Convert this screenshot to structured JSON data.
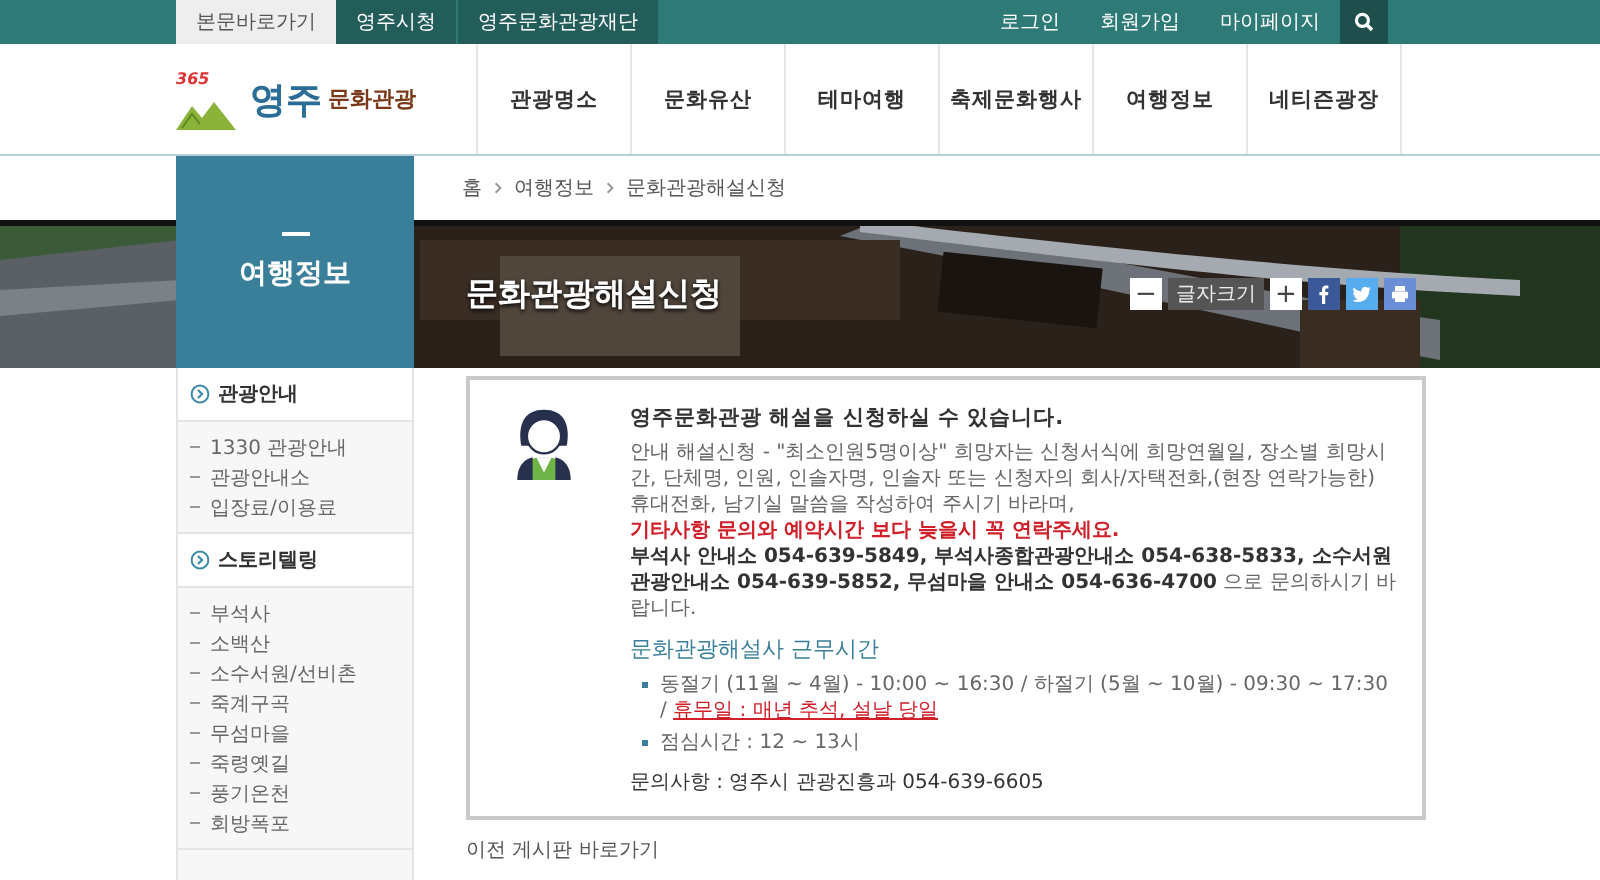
{
  "top_bar": {
    "left_links": [
      {
        "label": "본문바로가기",
        "kind": "skip"
      },
      {
        "label": "영주시청",
        "kind": "site"
      },
      {
        "label": "영주문화관광재단",
        "kind": "site"
      }
    ],
    "right_links": [
      "로그인",
      "회원가입",
      "마이페이지"
    ]
  },
  "logo": {
    "badge": "365",
    "city": "영주",
    "subtitle": "문화관광"
  },
  "nav": [
    "관광명소",
    "문화유산",
    "테마여행",
    "축제문화행사",
    "여행정보",
    "네티즌광장"
  ],
  "sidebar": {
    "title": "여행정보",
    "sections": [
      {
        "label": "관광안내",
        "items": [
          "1330 관광안내",
          "관광안내소",
          "입장료/이용료"
        ]
      },
      {
        "label": "스토리텔링",
        "items": [
          "부석사",
          "소백산",
          "소수서원/선비촌",
          "죽계구곡",
          "무섬마을",
          "죽령옛길",
          "풍기온천",
          "회방폭포"
        ]
      }
    ]
  },
  "breadcrumb": [
    "홈",
    "여행정보",
    "문화관광해설신청"
  ],
  "page_title": "문화관광해설신청",
  "font_size_control": {
    "decrease": "−",
    "label": "글자크기",
    "increase": "+"
  },
  "share_buttons": [
    {
      "kind": "facebook",
      "color": "#3b5998"
    },
    {
      "kind": "twitter",
      "color": "#55acee"
    },
    {
      "kind": "print",
      "color": "#6c8ed6"
    }
  ],
  "notice": {
    "heading": "영주문화관광 해설을 신청하실 수 있습니다.",
    "paragraphs": [
      {
        "kind": "plain",
        "text": "안내 해설신청 - \"최소인원5명이상\" 희망자는 신청서식에 희망연월일, 장소별 희망시간, 단체명, 인원, 인솔자명, 인솔자 또는 신청자의 회사/자택전화,(현장 연락가능한) 휴대전화, 남기실 말씀을 작성하여 주시기 바라며,"
      },
      {
        "kind": "warning",
        "text": "기타사항 문의와 예약시간 보다 늦을시 꼭 연락주세요."
      },
      {
        "kind": "plain",
        "text": "**부석사 안내소 054-639-5849, 부석사종합관광안내소 054-638-5833, 소수서원관광안내소 054-639-5852, 무섬마을 안내소 054-636-4700** 으로 문의하시기 바랍니다."
      }
    ],
    "hours_heading": "문화관광해설사 근무시간",
    "hours": [
      {
        "text": "동절기 (11월 ~ 4월) - 10:00 ~ 16:30 / 하절기 (5월 ~ 10월) - 09:30 ~ 17:30 / ",
        "note": "휴무일 : 매년 추석, 설날 당일"
      },
      {
        "text": "점심시간 : 12 ~ 13시"
      }
    ],
    "contact": "문의사항 : 영주시 관광진흥과 054-639-6605"
  },
  "back_link": "이전 게시판 바로가기"
}
